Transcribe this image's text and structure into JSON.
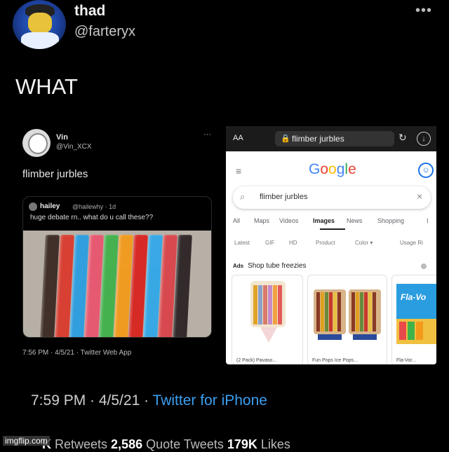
{
  "outer_tweet": {
    "name": "thad",
    "handle": "@farteryx",
    "more": "•••",
    "text": "WHAT",
    "time_line": "7:59 PM · 4/5/21 · ",
    "source": "Twitter for iPhone",
    "stats": {
      "retweets_count": "K",
      "retweets_label": " Retweets ",
      "quotes_count": "2,586",
      "quotes_label": " Quote Tweets ",
      "likes_count": "179K",
      "likes_label": " Likes"
    }
  },
  "inner_tweet": {
    "name": "Vin",
    "handle": "@Vin_XCX",
    "more": "···",
    "text": "flimber jurbles",
    "time": "7:56 PM · 4/5/21 · Twitter Web App",
    "quoted": {
      "name": "hailey",
      "handle": "@hailewhy · 1d",
      "text": "huge debate rn.. what do u call these??"
    },
    "ice_pop_colors": [
      "#3a2a22",
      "#d83a2c",
      "#2a9de0",
      "#e8566e",
      "#3fb24a",
      "#f39a1a",
      "#d8231f",
      "#32a8e8",
      "#d9444a",
      "#2c2424"
    ]
  },
  "google": {
    "aa": "AA",
    "url": "flimber jurbles",
    "reload": "↻",
    "download": "↓",
    "menu": "≡",
    "logo": [
      "G",
      "o",
      "o",
      "g",
      "l",
      "e"
    ],
    "logo_colors": [
      "#4285f4",
      "#ea4335",
      "#fbbc05",
      "#4285f4",
      "#34a853",
      "#ea4335"
    ],
    "account": "☺",
    "search_text": "flimber jurbles",
    "search_clear": "×",
    "tabs": [
      "All",
      "Maps",
      "Videos",
      "Images",
      "News",
      "Shopping",
      "I"
    ],
    "active_tab": "Images",
    "filters": [
      "Latest",
      "GIF",
      "HD",
      "Product",
      "Color ▾",
      "Usage Ri"
    ],
    "ads_label": "Ads",
    "ads_title": "Shop tube freezies",
    "products": [
      {
        "label": "(2 Pack) Pavaso..."
      },
      {
        "label": "Fun Pops Ice Pops..."
      },
      {
        "label": "Fla-Vor..."
      }
    ],
    "product3_brand": "Fla-Vo"
  },
  "watermark": "imgflip.com"
}
